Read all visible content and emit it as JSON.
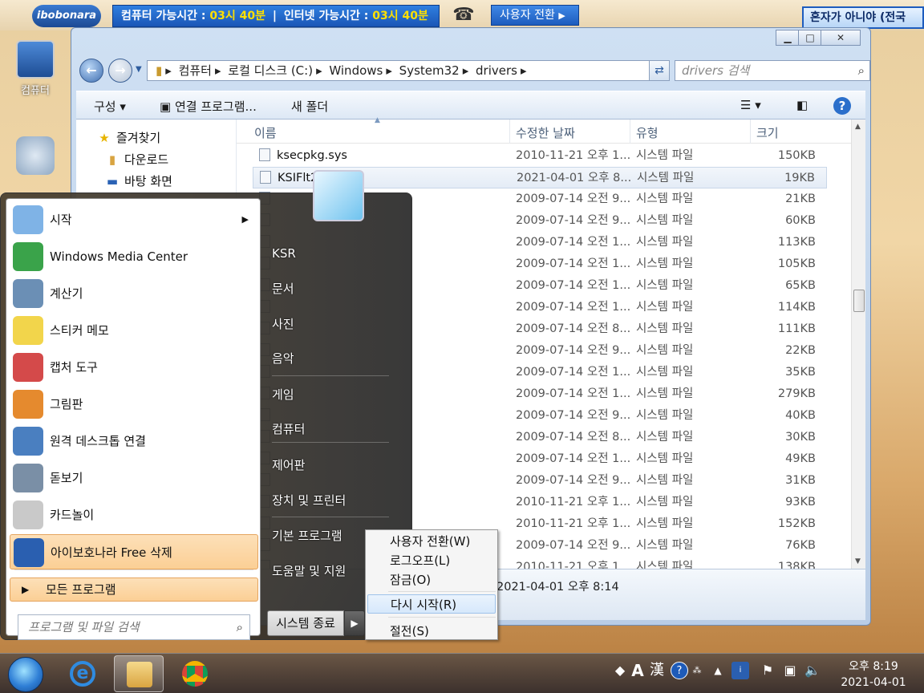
{
  "topbar": {
    "logo": "ibobonara",
    "time_pc_label": "컴퓨터 가능시간 : ",
    "time_pc_value": "03시 40분",
    "time_net_label": "인터넷 가능시간 : ",
    "time_net_value": "03시 40분",
    "user_switch": "사용자 전환",
    "banner": "혼자가 아니야 (전국"
  },
  "desktop": {
    "icons": [
      {
        "label": "컴퓨터",
        "icon": "computer-icon"
      },
      {
        "label": "",
        "icon": "recycle-bin-icon"
      }
    ]
  },
  "explorer": {
    "breadcrumb": [
      "컴퓨터",
      "로컬 디스크 (C:)",
      "Windows",
      "System32",
      "drivers"
    ],
    "search_placeholder": "drivers 검색",
    "toolbar": {
      "organize": "구성",
      "open_with": "연결 프로그램...",
      "new_folder": "새 폴더"
    },
    "nav": [
      {
        "label": "즐겨찾기",
        "icon": "star-icon"
      },
      {
        "label": "다운로드",
        "icon": "download-folder-icon"
      },
      {
        "label": "바탕 화면",
        "icon": "desktop-icon"
      }
    ],
    "columns": {
      "name": "이름",
      "date": "수정한 날짜",
      "type": "유형",
      "size": "크기"
    },
    "files": [
      {
        "name": "ksecpkg.sys",
        "date": "2010-11-21 오후 1...",
        "type": "시스템 파일",
        "size": "150KB"
      },
      {
        "name": "KSIFlt2",
        "date": "2021-04-01 오후 8...",
        "type": "시스템 파일",
        "size": "19KB",
        "selected": true
      },
      {
        "name": "",
        "date": "2009-07-14 오전 9...",
        "type": "시스템 파일",
        "size": "21KB"
      },
      {
        "name": "",
        "date": "2009-07-14 오전 9...",
        "type": "시스템 파일",
        "size": "60KB"
      },
      {
        "name": "",
        "date": "2009-07-14 오전 1...",
        "type": "시스템 파일",
        "size": "113KB"
      },
      {
        "name": "",
        "date": "2009-07-14 오전 1...",
        "type": "시스템 파일",
        "size": "105KB"
      },
      {
        "name": "",
        "date": "2009-07-14 오전 1...",
        "type": "시스템 파일",
        "size": "65KB"
      },
      {
        "name": "",
        "date": "2009-07-14 오전 1...",
        "type": "시스템 파일",
        "size": "114KB"
      },
      {
        "name": "",
        "date": "2009-07-14 오전 8...",
        "type": "시스템 파일",
        "size": "111KB"
      },
      {
        "name": "",
        "date": "2009-07-14 오전 9...",
        "type": "시스템 파일",
        "size": "22KB"
      },
      {
        "name": "",
        "date": "2009-07-14 오전 1...",
        "type": "시스템 파일",
        "size": "35KB"
      },
      {
        "name": "",
        "date": "2009-07-14 오전 1...",
        "type": "시스템 파일",
        "size": "279KB"
      },
      {
        "name": "",
        "date": "2009-07-14 오전 9...",
        "type": "시스템 파일",
        "size": "40KB"
      },
      {
        "name": "",
        "date": "2009-07-14 오전 8...",
        "type": "시스템 파일",
        "size": "30KB"
      },
      {
        "name": "",
        "date": "2009-07-14 오전 1...",
        "type": "시스템 파일",
        "size": "49KB"
      },
      {
        "name": "",
        "date": "2009-07-14 오전 9...",
        "type": "시스템 파일",
        "size": "31KB"
      },
      {
        "name": "",
        "date": "2010-11-21 오후 1...",
        "type": "시스템 파일",
        "size": "93KB"
      },
      {
        "name": "",
        "date": "2010-11-21 오후 1...",
        "type": "시스템 파일",
        "size": "152KB"
      },
      {
        "name": "",
        "date": "2009-07-14 오전 9...",
        "type": "시스템 파일",
        "size": "76KB"
      },
      {
        "name": "",
        "date": "2010-11-21 오후 1...",
        "type": "시스템 파일",
        "size": "138KB"
      }
    ],
    "details_date": "2021-04-01 오후 8:14"
  },
  "start_menu": {
    "programs": [
      {
        "label": "시작",
        "icon": "getting-started-icon",
        "submenu": true
      },
      {
        "label": "Windows Media Center",
        "icon": "media-center-icon"
      },
      {
        "label": "계산기",
        "icon": "calculator-icon"
      },
      {
        "label": "스티커 메모",
        "icon": "sticky-notes-icon"
      },
      {
        "label": "캡처 도구",
        "icon": "snipping-tool-icon"
      },
      {
        "label": "그림판",
        "icon": "paint-icon"
      },
      {
        "label": "원격 데스크톱 연결",
        "icon": "remote-desktop-icon"
      },
      {
        "label": "돋보기",
        "icon": "magnifier-icon"
      },
      {
        "label": "카드놀이",
        "icon": "solitaire-icon"
      },
      {
        "label": "아이보호나라 Free 삭제",
        "icon": "ibobo-uninstall-icon",
        "highlight": true
      }
    ],
    "all_programs": "모든 프로그램",
    "search_placeholder": "프로그램 및 파일 검색",
    "right_items": [
      "KSR",
      "문서",
      "사진",
      "음악",
      "게임",
      "컴퓨터",
      "제어판",
      "장치 및 프린터",
      "기본 프로그램",
      "도움말 및 지원"
    ],
    "shutdown": "시스템 종료"
  },
  "power_menu": {
    "items": [
      "사용자 전환(W)",
      "로그오프(L)",
      "잠금(O)",
      "다시 시작(R)",
      "절전(S)"
    ],
    "highlight_index": 3
  },
  "taskbar": {
    "ime_label": "A",
    "ime_hanja": "漢",
    "clock_time": "오후 8:19",
    "clock_date": "2021-04-01"
  }
}
